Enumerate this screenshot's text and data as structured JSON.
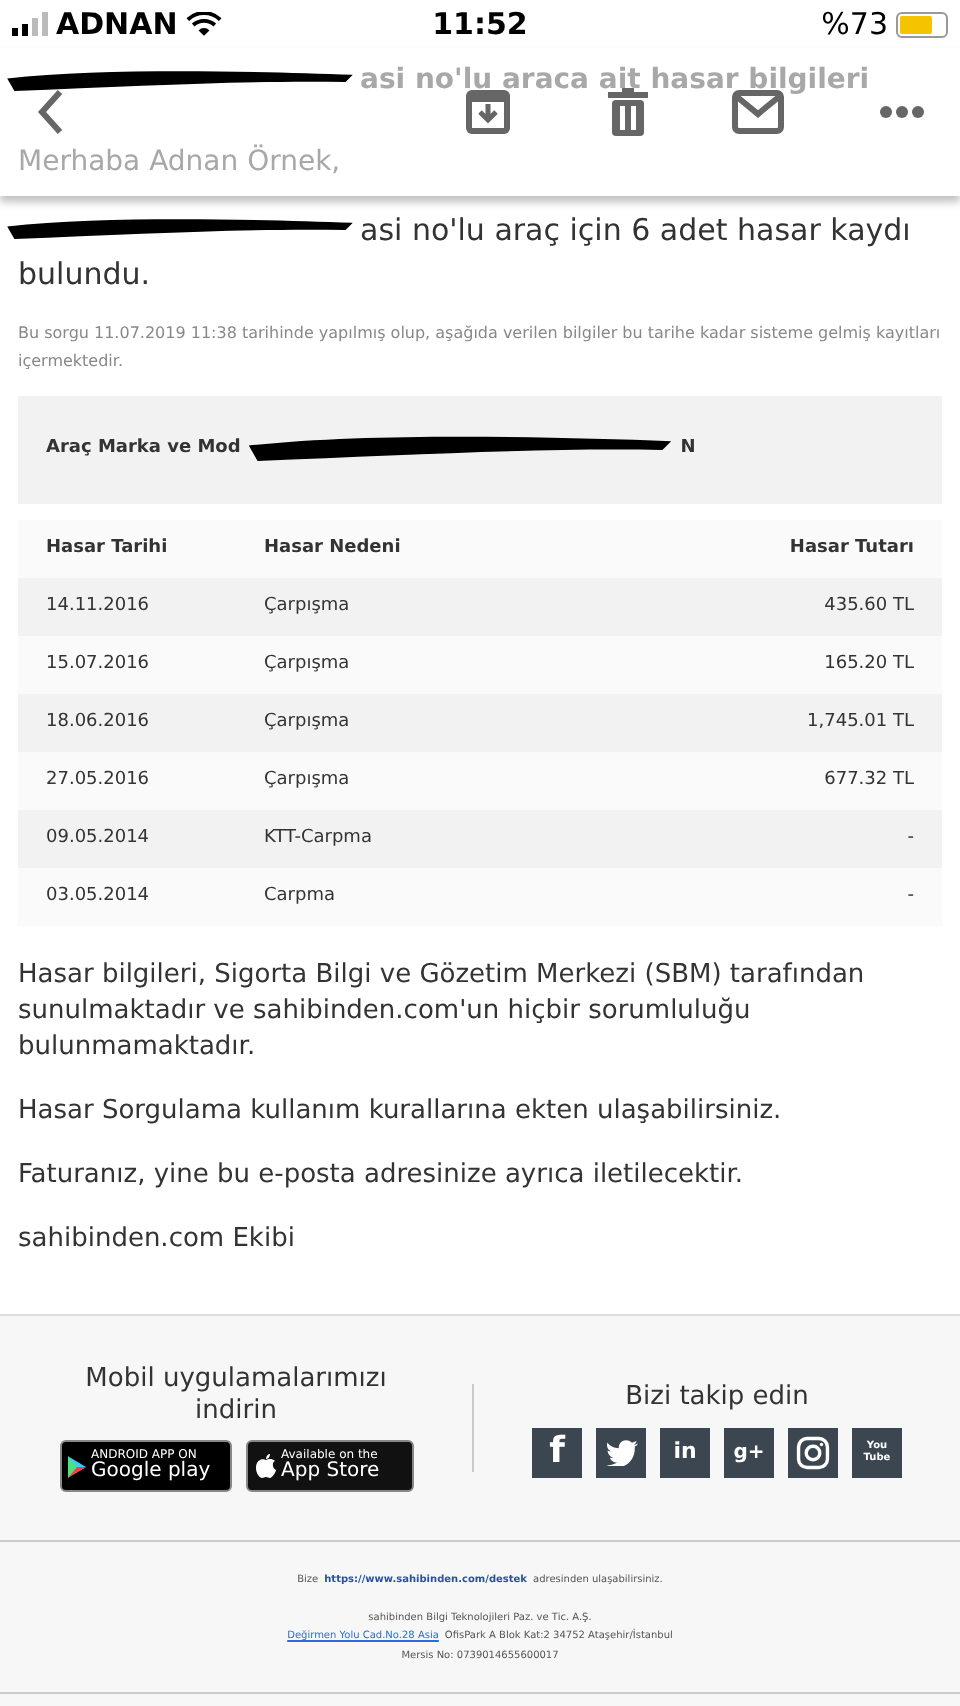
{
  "status_bar": {
    "carrier": "ADNAN",
    "time": "11:52",
    "battery_text": "%73"
  },
  "header": {
    "title_fragment": "asi no'lu araca ait hasar bilgileri",
    "greeting": "Merhaba Adnan Örnek,"
  },
  "intro": {
    "fragment": "asi no'lu araç için 6 adet hasar kaydı",
    "fragment_end": "bulundu.",
    "note": "Bu sorgu 11.07.2019 11:38 tarihinde yapılmış olup, aşağıda verilen bilgiler bu tarihe kadar sisteme gelmiş kayıtları içermektedir."
  },
  "vehicle": {
    "label_fragment": "Araç Marka ve Mod",
    "value_fragment": "N"
  },
  "table": {
    "columns": [
      "Hasar Tarihi",
      "Hasar Nedeni",
      "Hasar Tutarı"
    ],
    "rows": [
      [
        "14.11.2016",
        "Çarpışma",
        "435.60 TL"
      ],
      [
        "15.07.2016",
        "Çarpışma",
        "165.20 TL"
      ],
      [
        "18.06.2016",
        "Çarpışma",
        "1,745.01 TL"
      ],
      [
        "27.05.2016",
        "Çarpışma",
        "677.32 TL"
      ],
      [
        "09.05.2014",
        "KTT-Carpma",
        "-"
      ],
      [
        "03.05.2014",
        "Carpma",
        "-"
      ]
    ]
  },
  "paragraphs": [
    "Hasar bilgileri, Sigorta Bilgi ve Gözetim Merkezi (SBM) tarafından sunulmaktadır ve sahibinden.com'un hiçbir sorumluluğu bulunmamaktadır.",
    "Hasar Sorgulama kullanım kurallarına ekten ulaşabilirsiniz.",
    "Faturanız, yine bu e-posta adresinize ayrıca iletilecektir.",
    "sahibinden.com Ekibi"
  ],
  "footer": {
    "apps_heading": "Mobil uygulamalarımızı indirin",
    "google_play": {
      "small": "ANDROID APP ON",
      "big": "Google play"
    },
    "app_store": {
      "small": "Available on the",
      "big": "App Store"
    },
    "social_heading": "Bizi takip edin",
    "social": [
      {
        "kind": "facebook",
        "text": "f"
      },
      {
        "kind": "twitter"
      },
      {
        "kind": "linkedin",
        "text": "in"
      },
      {
        "kind": "googleplus",
        "text": "g+"
      },
      {
        "kind": "instagram"
      },
      {
        "kind": "youtube",
        "text": "You Tube"
      }
    ],
    "contact_before": "Bize",
    "contact_link": "https://www.sahibinden.com/destek",
    "contact_after": "adresinden ulaşabilirsiniz.",
    "company": "sahibinden Bilgi Teknolojileri Paz. ve Tic. A.Ş.",
    "address_link": "Değirmen Yolu Cad.No.28 Asia",
    "address_rest": "OfisPark A Blok Kat:2 34752 Ataşehir/İstanbul",
    "mersis": "Mersis No: 0739014655600017"
  }
}
